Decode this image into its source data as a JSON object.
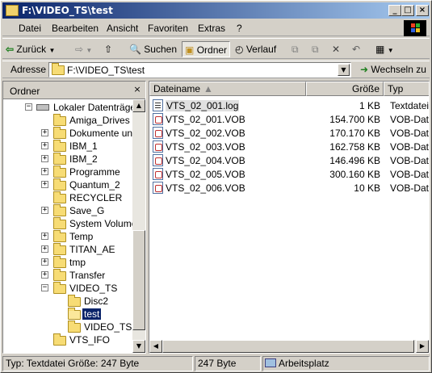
{
  "window": {
    "title": "F:\\VIDEO_TS\\test",
    "minimize": "_",
    "maximize": "□",
    "close": "×"
  },
  "menu": [
    {
      "label": "Datei"
    },
    {
      "label": "Bearbeiten"
    },
    {
      "label": "Ansicht"
    },
    {
      "label": "Favoriten"
    },
    {
      "label": "Extras"
    },
    {
      "label": "?"
    }
  ],
  "toolbar": {
    "back": "Zurück",
    "search": "Suchen",
    "folders": "Ordner",
    "history": "Verlauf"
  },
  "address": {
    "label": "Adresse",
    "value": "F:\\VIDEO_TS\\test",
    "go": "Wechseln zu"
  },
  "folders_pane": {
    "title": "Ordner",
    "close": "×",
    "items": [
      {
        "label": "Lokaler Datenträger"
      },
      {
        "label": "Amiga_Drives"
      },
      {
        "label": "Dokumente und"
      },
      {
        "label": "IBM_1"
      },
      {
        "label": "IBM_2"
      },
      {
        "label": "Programme"
      },
      {
        "label": "Quantum_2"
      },
      {
        "label": "RECYCLER"
      },
      {
        "label": "Save_G"
      },
      {
        "label": "System Volume I"
      },
      {
        "label": "Temp"
      },
      {
        "label": "TITAN_AE"
      },
      {
        "label": "tmp"
      },
      {
        "label": "Transfer"
      },
      {
        "label": "VIDEO_TS"
      },
      {
        "label": "Disc2"
      },
      {
        "label": "test"
      },
      {
        "label": "VIDEO_TS"
      },
      {
        "label": "VTS_IFO"
      }
    ]
  },
  "file_list": {
    "columns": [
      "Dateiname",
      "Größe",
      "Typ"
    ],
    "rows": [
      {
        "name": "VTS_02_001.log",
        "size": "1 KB",
        "type": "Textdatei",
        "icon": "text-file-icon"
      },
      {
        "name": "VTS_02_001.VOB",
        "size": "154.700 KB",
        "type": "VOB-Datei",
        "icon": "vob-file-icon"
      },
      {
        "name": "VTS_02_002.VOB",
        "size": "170.170 KB",
        "type": "VOB-Datei",
        "icon": "vob-file-icon"
      },
      {
        "name": "VTS_02_003.VOB",
        "size": "162.758 KB",
        "type": "VOB-Datei",
        "icon": "vob-file-icon"
      },
      {
        "name": "VTS_02_004.VOB",
        "size": "146.496 KB",
        "type": "VOB-Datei",
        "icon": "vob-file-icon"
      },
      {
        "name": "VTS_02_005.VOB",
        "size": "300.160 KB",
        "type": "VOB-Datei",
        "icon": "vob-file-icon"
      },
      {
        "name": "VTS_02_006.VOB",
        "size": "10 KB",
        "type": "VOB-Datei",
        "icon": "vob-file-icon"
      }
    ]
  },
  "status": {
    "info": "Typ: Textdatei Größe: 247 Byte",
    "size": "247 Byte",
    "zone": "Arbeitsplatz"
  },
  "colors": {
    "title_start": "#0a246a",
    "title_end": "#a6caf0",
    "face": "#d4d0c8",
    "selection": "#0a246a"
  }
}
